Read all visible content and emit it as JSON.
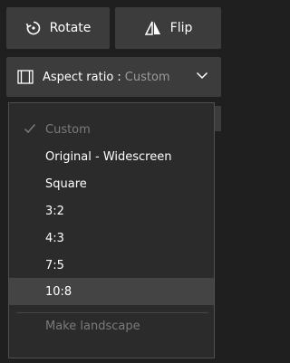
{
  "toolbar": {
    "rotate_label": "Rotate",
    "flip_label": "Flip"
  },
  "aspect": {
    "label": "Aspect ratio :",
    "value": "Custom"
  },
  "menu": {
    "items": [
      {
        "label": "Custom",
        "state": "disabled",
        "checked": true
      },
      {
        "label": "Original - Widescreen",
        "state": "enabled"
      },
      {
        "label": "Square",
        "state": "enabled"
      },
      {
        "label": "3:2",
        "state": "enabled"
      },
      {
        "label": "4:3",
        "state": "enabled"
      },
      {
        "label": "7:5",
        "state": "enabled"
      },
      {
        "label": "10:8",
        "state": "hover"
      },
      {
        "label": "Make landscape",
        "state": "disabled"
      }
    ]
  },
  "colors": {
    "background": "#1f1f1f",
    "button": "#3c3c3c",
    "menu": "#2b2b2b",
    "hover": "#444444",
    "disabled_text": "#7b7b7b"
  }
}
